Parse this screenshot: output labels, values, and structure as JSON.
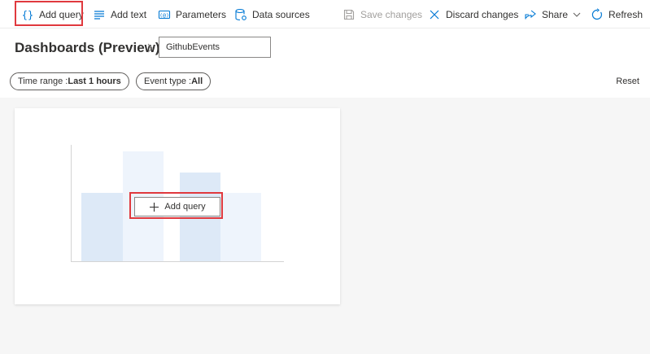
{
  "toolbar": {
    "add_query": "Add query",
    "add_text": "Add text",
    "parameters": "Parameters",
    "data_sources": "Data sources",
    "save_changes": "Save changes",
    "discard_changes": "Discard changes",
    "share": "Share",
    "refresh": "Refresh"
  },
  "header": {
    "title": "Dashboards (Preview)",
    "dashboard_name_value": "GithubEvents"
  },
  "filters": [
    {
      "label": "Time range : ",
      "value": "Last 1 hours"
    },
    {
      "label": "Event type : ",
      "value": "All"
    }
  ],
  "reset_label": "Reset",
  "card": {
    "add_query_label": "Add query"
  },
  "colors": {
    "highlight": "#e0393e",
    "accent": "#0078d4",
    "bar_dark": "#dde9f7",
    "bar_light": "#eef4fc"
  },
  "icons": {
    "add_query": "braces-icon",
    "add_text": "text-lines-icon",
    "parameters": "parameters-icon",
    "data_sources": "database-icon",
    "save_changes": "save-icon",
    "discard_changes": "close-icon",
    "share": "share-icon",
    "refresh": "refresh-icon"
  }
}
